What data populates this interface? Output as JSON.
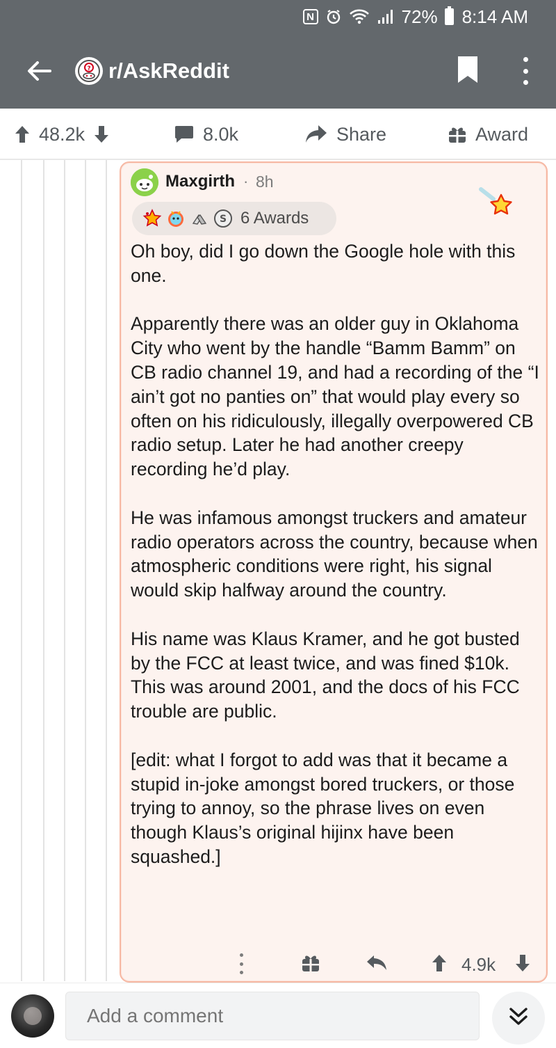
{
  "status_bar": {
    "battery": "72%",
    "time": "8:14 AM"
  },
  "header": {
    "subreddit": "r/AskReddit"
  },
  "post_actions": {
    "score": "48.2k",
    "comments": "8.0k",
    "share_label": "Share",
    "award_label": "Award"
  },
  "comment": {
    "author": "Maxgirth",
    "separator": "·",
    "age": "8h",
    "awards_label": "6 Awards",
    "paragraphs": [
      "Oh boy, did I go down the Google hole with this one.",
      "Apparently there was an older guy in Oklahoma City who went by the handle “Bamm Bamm” on CB radio channel 19, and had a recording of the “I ain’t got no panties on” that would play every so often on his ridiculously, illegally overpowered CB radio setup. Later he had another creepy recording he’d play.",
      "He was infamous amongst truckers and amateur radio operators across the country, because when atmospheric conditions were right, his signal would skip halfway around the country.",
      "His name was Klaus Kramer, and he got busted by the FCC at least twice, and was fined $10k. This was around 2001, and the docs of his FCC trouble are public.",
      "[edit: what I forgot to add was that it became a stupid in-joke amongst bored truckers, or those trying to annoy, so the phrase lives on even though Klaus’s original hijinx have been squashed.]"
    ],
    "score": "4.9k"
  },
  "composer": {
    "placeholder": "Add a comment"
  },
  "colors": {
    "header_bg": "#63686c",
    "card_bg": "#fdf3ef",
    "card_border": "#f6b8a3",
    "avatar_green": "#8bd14a"
  }
}
